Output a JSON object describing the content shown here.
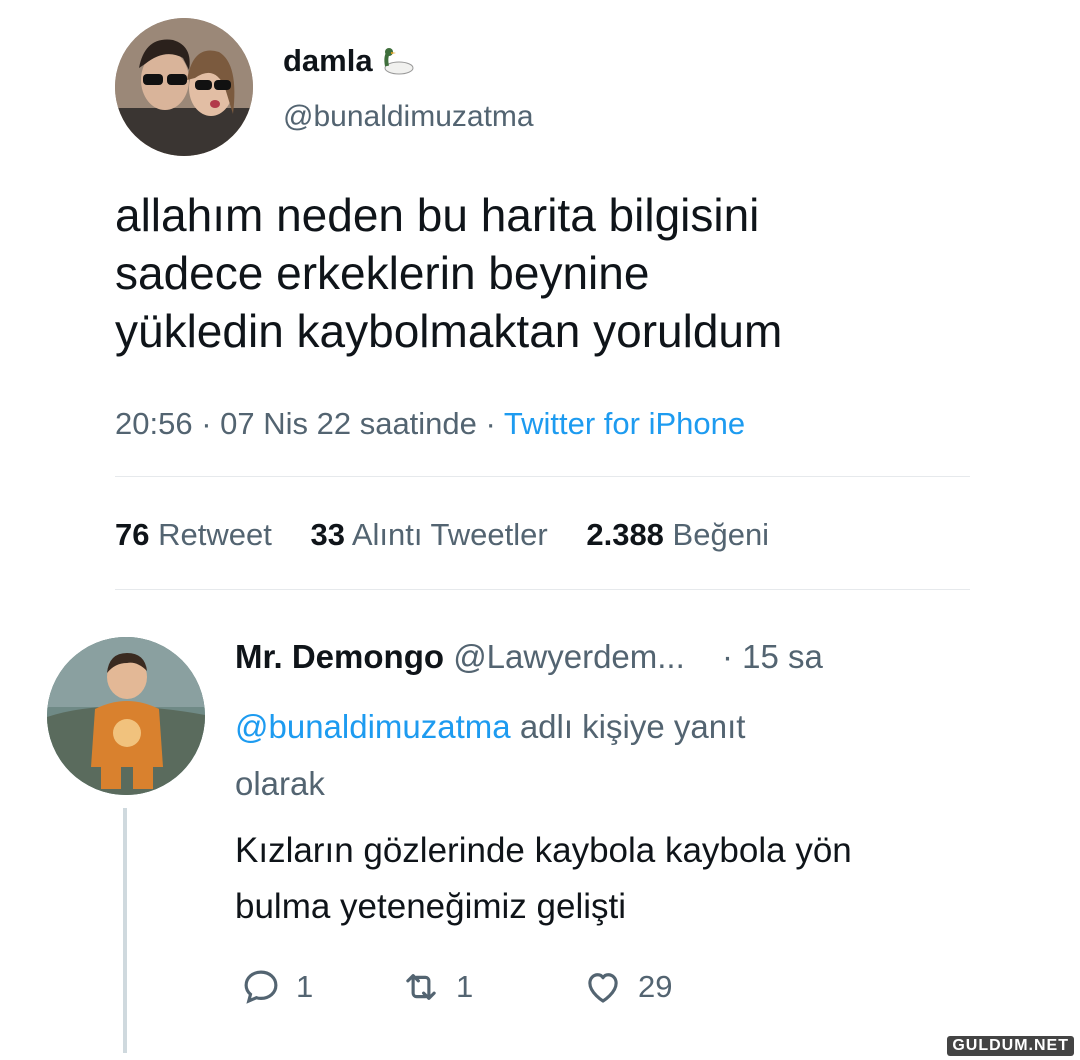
{
  "tweet": {
    "display_name": "damla",
    "handle": "@bunaldimuzatma",
    "text_lines": [
      "allahım neden bu harita bilgisini",
      "sadece erkeklerin beynine",
      "yükledin kaybolmaktan yoruldum"
    ],
    "timestamp": "20:56 · 07 Nis 22 saatinde ·",
    "source": "Twitter for iPhone",
    "stats": {
      "retweets": "76",
      "retweets_label": "Retweet",
      "quotes": "33",
      "quotes_label": "Alıntı Tweetler",
      "likes": "2.388",
      "likes_label": "Beğeni"
    }
  },
  "reply": {
    "display_name": "Mr. Demongo",
    "handle": "@Lawyerdem...",
    "time": "· 15 sa",
    "reply_mention": "@bunaldimuzatma",
    "reply_suffix": "adlı kişiye yanıt",
    "reply_suffix2": "olarak",
    "text_lines": [
      "Kızların gözlerinde kaybola kaybola yön",
      "bulma yeteneğimiz gelişti"
    ],
    "actions": {
      "replies": "1",
      "retweets": "1",
      "likes": "29"
    }
  },
  "watermark": "GULDUM.NET",
  "colors": {
    "text": "#0f1419",
    "secondary": "#536471",
    "link": "#1d9bf0",
    "divider": "#e6e9ec"
  }
}
